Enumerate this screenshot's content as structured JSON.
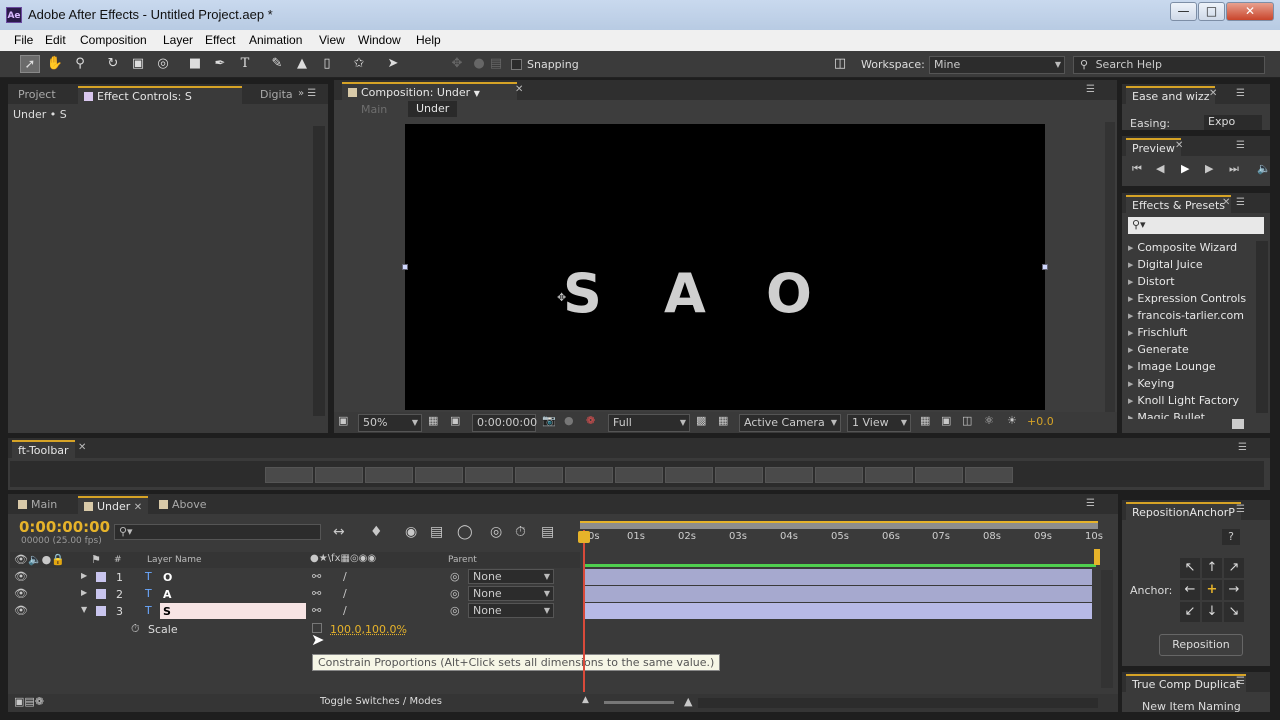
{
  "window": {
    "title": "Adobe After Effects - Untitled Project.aep *",
    "app_icon": "Ae"
  },
  "menu": [
    "File",
    "Edit",
    "Composition",
    "Layer",
    "Effect",
    "Animation",
    "View",
    "Window",
    "Help"
  ],
  "toolbar": {
    "snapping_label": "Snapping",
    "workspace_label": "Workspace:",
    "workspace_value": "Mine",
    "search_placeholder": "Search Help"
  },
  "left_panel": {
    "tab_project": "Project",
    "tab_effect_controls": "Effect Controls: S",
    "tab_digital": "Digita",
    "header": "Under • S"
  },
  "composition": {
    "tab": "Composition: Under",
    "crumb_main": "Main",
    "crumb_under": "Under",
    "letters": [
      "S",
      "A",
      "O"
    ],
    "zoom": "50%",
    "timecode": "0:00:00:00",
    "resolution": "Full",
    "camera": "Active Camera",
    "views": "1 View",
    "exposure": "+0.0"
  },
  "ease_panel": {
    "tab": "Ease and wizz",
    "easing_label": "Easing:",
    "easing_value": "Expo"
  },
  "preview_panel": {
    "tab": "Preview"
  },
  "effects_presets": {
    "tab": "Effects & Presets",
    "items": [
      "Composite Wizard",
      "Digital Juice",
      "Distort",
      "Expression Controls",
      "francois-tarlier.com",
      "Frischluft",
      "Generate",
      "Image Lounge",
      "Keying",
      "Knoll Light Factory",
      "Magic Bullet Colorista"
    ]
  },
  "ft_toolbar": {
    "tab": "ft-Toolbar"
  },
  "timeline": {
    "tabs": [
      "Main",
      "Under",
      "Above"
    ],
    "timecode": "0:00:00:00",
    "frame_info": "00000 (25.00 fps)",
    "col_layer_name": "Layer Name",
    "col_parent": "Parent",
    "layers": [
      {
        "num": "1",
        "name": "O",
        "parent": "None"
      },
      {
        "num": "2",
        "name": "A",
        "parent": "None"
      },
      {
        "num": "3",
        "name": "S",
        "parent": "None"
      }
    ],
    "property_name": "Scale",
    "property_value": "100.0,100.0%",
    "ticks": [
      "0s",
      "01s",
      "02s",
      "03s",
      "04s",
      "05s",
      "06s",
      "07s",
      "08s",
      "09s",
      "10s"
    ],
    "tooltip": "Constrain Proportions (Alt+Click sets all dimensions to the same value.)",
    "toggle_label": "Toggle Switches / Modes"
  },
  "reposition_panel": {
    "tab": "RepositionAnchorP",
    "help": "?",
    "anchor_label": "Anchor:",
    "button": "Reposition"
  },
  "true_comp_panel": {
    "tab": "True Comp Duplicat",
    "item": "New Item Naming"
  }
}
